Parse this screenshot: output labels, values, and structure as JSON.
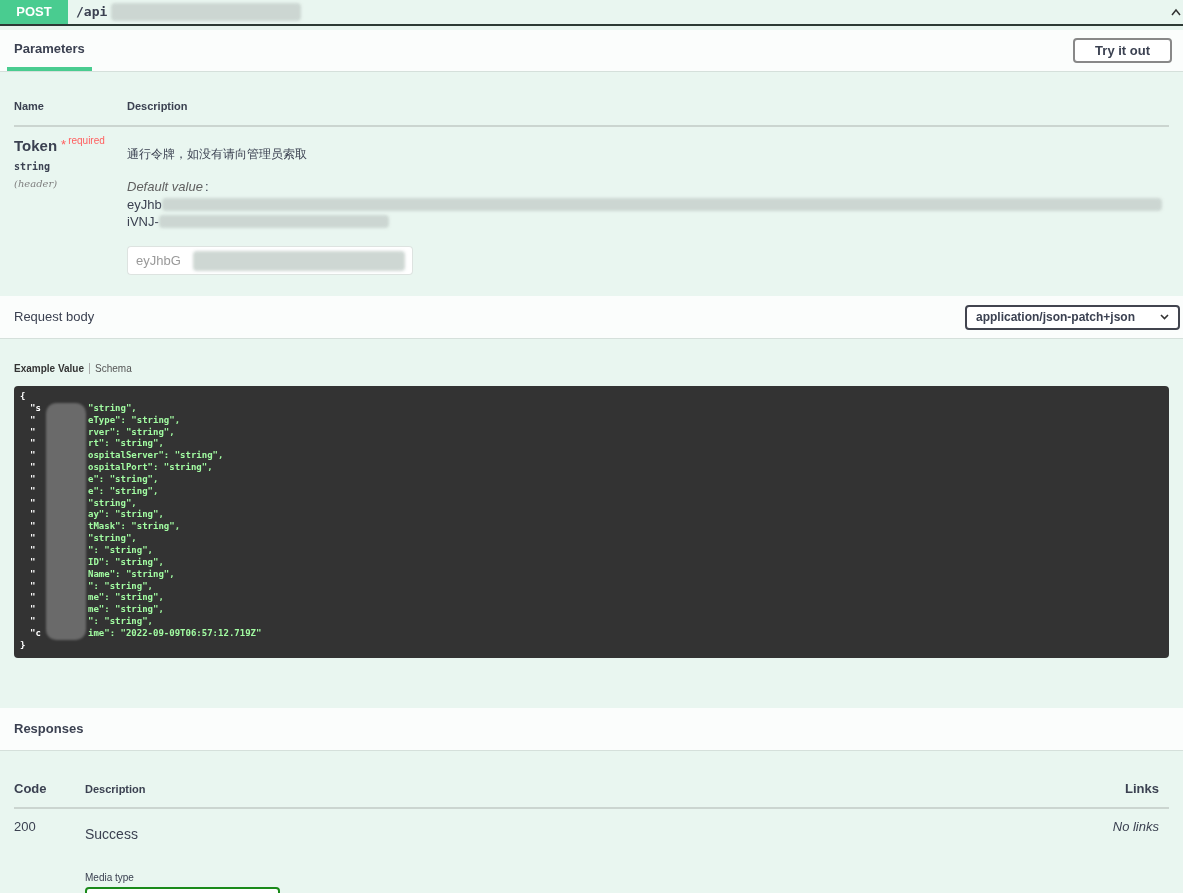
{
  "summary": {
    "method": "POST",
    "path": "/api",
    "expanded": true
  },
  "tabs": [
    {
      "label": "Parameters",
      "selected": true
    }
  ],
  "try_button": "Try it out",
  "params_table": {
    "columns": [
      "Name",
      "Description"
    ],
    "rows": [
      {
        "name": "Token",
        "required_mark": "*",
        "required_label": "required",
        "type": "string",
        "location": "(header)",
        "description": "通行令牌，如没有请向管理员索取",
        "default_label": "Default value",
        "default_sep": ":",
        "default_lines": [
          "eyJhb",
          "iVNJ-"
        ],
        "input_value": "eyJhbG"
      }
    ]
  },
  "request_body": {
    "label": "Request body",
    "content_type": "application/json-patch+json"
  },
  "example_tabs": [
    {
      "label": "Example Value",
      "selected": true
    },
    {
      "label": "Schema",
      "selected": false
    }
  ],
  "code": {
    "open": "{",
    "close": "}",
    "lines": [
      {
        "head": "\"s",
        "tail": "\"string\","
      },
      {
        "head": "\"",
        "tail": "eType\": \"string\","
      },
      {
        "head": "\"",
        "tail": "rver\": \"string\","
      },
      {
        "head": "\"",
        "tail": "rt\": \"string\","
      },
      {
        "head": "\"",
        "tail": "ospitalServer\": \"string\","
      },
      {
        "head": "\"",
        "tail": "ospitalPort\": \"string\","
      },
      {
        "head": "\"",
        "tail": "e\": \"string\","
      },
      {
        "head": "\"",
        "tail": "e\": \"string\","
      },
      {
        "head": "\"",
        "tail": "\"string\","
      },
      {
        "head": "\"",
        "tail": "ay\": \"string\","
      },
      {
        "head": "\"",
        "tail": "tMask\": \"string\","
      },
      {
        "head": "\"",
        "tail": "\"string\","
      },
      {
        "head": "\"",
        "tail": "\": \"string\","
      },
      {
        "head": "\"",
        "tail": "ID\": \"string\","
      },
      {
        "head": "\"",
        "tail": "Name\": \"string\","
      },
      {
        "head": "\"",
        "tail": "\": \"string\","
      },
      {
        "head": "\"",
        "tail": "me\": \"string\","
      },
      {
        "head": "\"",
        "tail": "me\": \"string\","
      },
      {
        "head": "\"",
        "tail": "\": \"string\","
      },
      {
        "head": "\"c",
        "tail": "ime\": \"2022-09-09T06:57:12.719Z\""
      }
    ]
  },
  "responses": {
    "title": "Responses",
    "columns": [
      "Code",
      "Description",
      "Links"
    ],
    "rows": [
      {
        "code": "200",
        "description": "Success",
        "links": "No links",
        "media_label": "Media type"
      }
    ]
  }
}
